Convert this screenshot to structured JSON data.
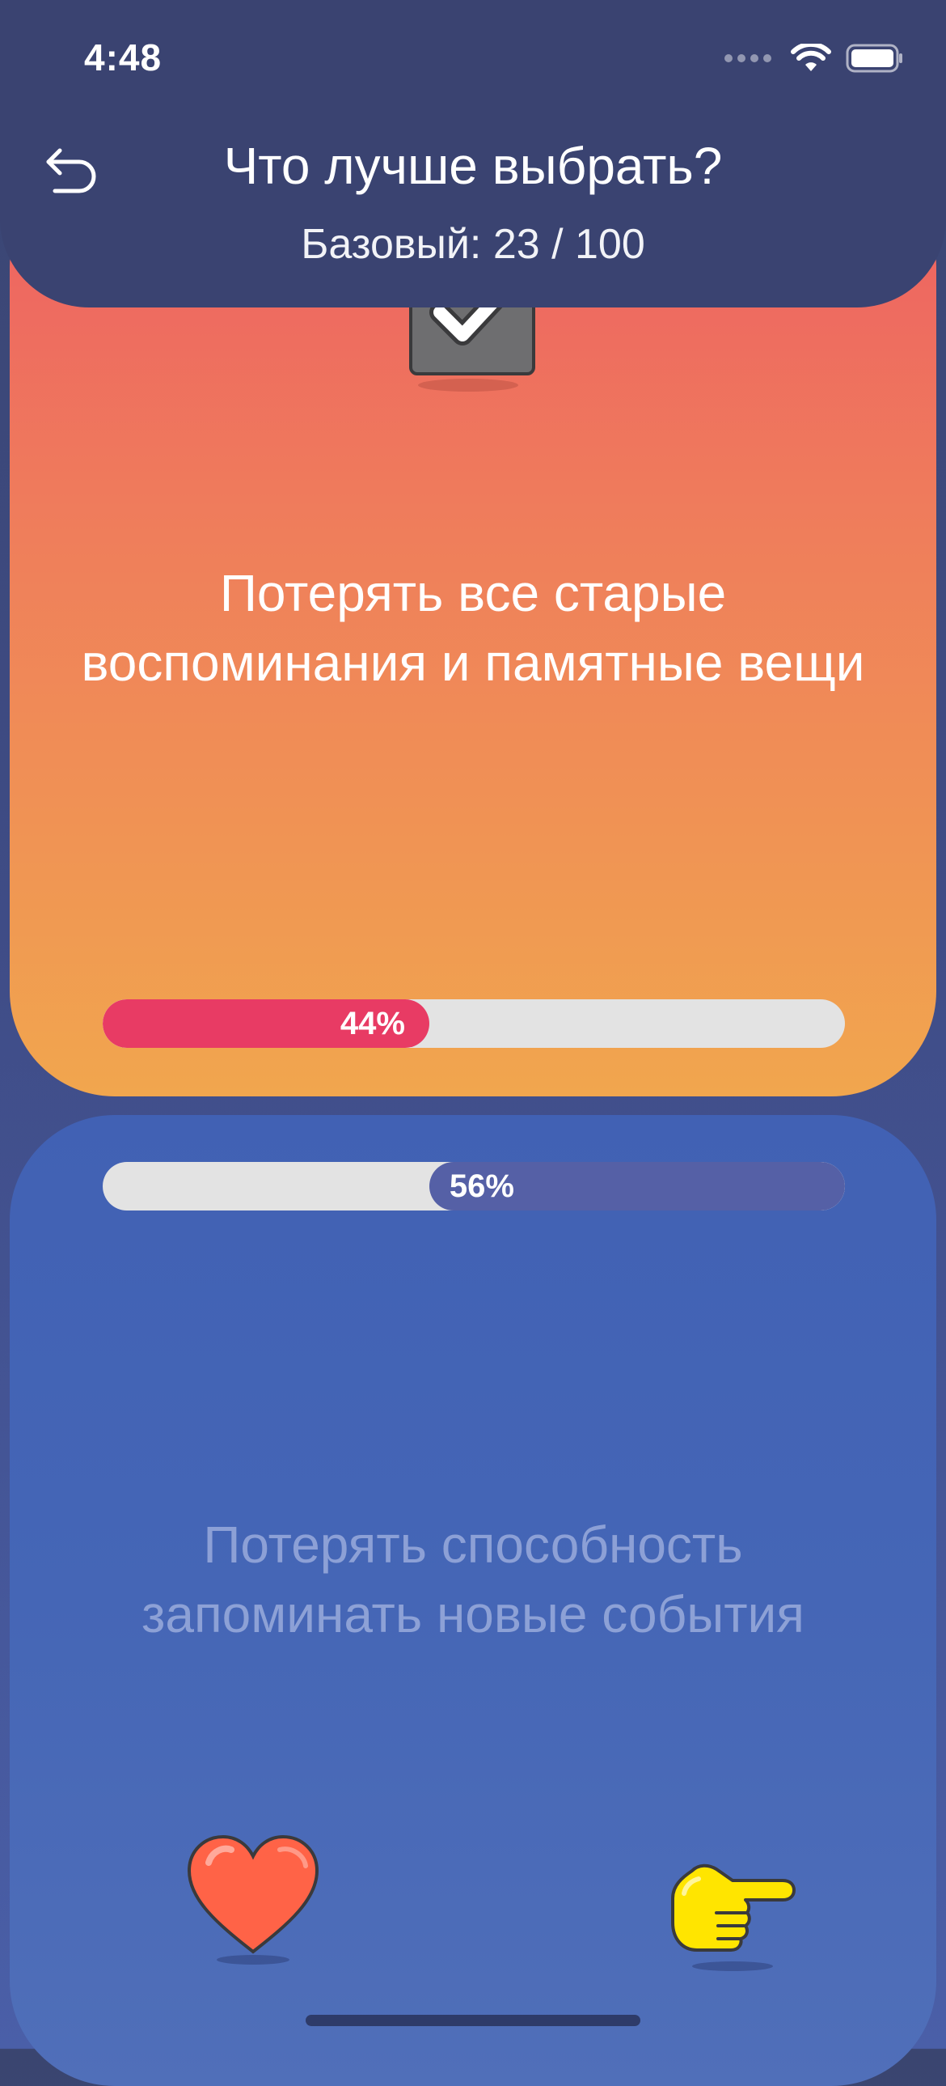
{
  "status_bar": {
    "time": "4:48"
  },
  "header": {
    "title": "Что лучше выбрать?",
    "progress_text": "Базовый: 23 / 100"
  },
  "options": {
    "top": {
      "text": "Потерять все старые воспоминания и памятные вещи",
      "percent_label": "44%",
      "percent_value": 44,
      "selected": true
    },
    "bottom": {
      "text": "Потерять способность запоминать новые события",
      "percent_label": "56%",
      "percent_value": 56,
      "selected": false
    }
  },
  "icons": {
    "back": "undo-arrow-icon",
    "check": "checkbox-checked-icon",
    "heart": "heart-icon",
    "next": "pointing-hand-icon",
    "wifi": "wifi-icon",
    "battery": "battery-icon"
  },
  "colors": {
    "header_bg": "#3a4371",
    "top_card_gradient": [
      "#ee5f63",
      "#f1a64e"
    ],
    "bottom_card_gradient": [
      "#4161b4",
      "#506fb9"
    ],
    "top_bar_fill": "#e83b64",
    "bottom_bar_fill": "#5560a6",
    "bar_track": "#e3e3e3"
  }
}
